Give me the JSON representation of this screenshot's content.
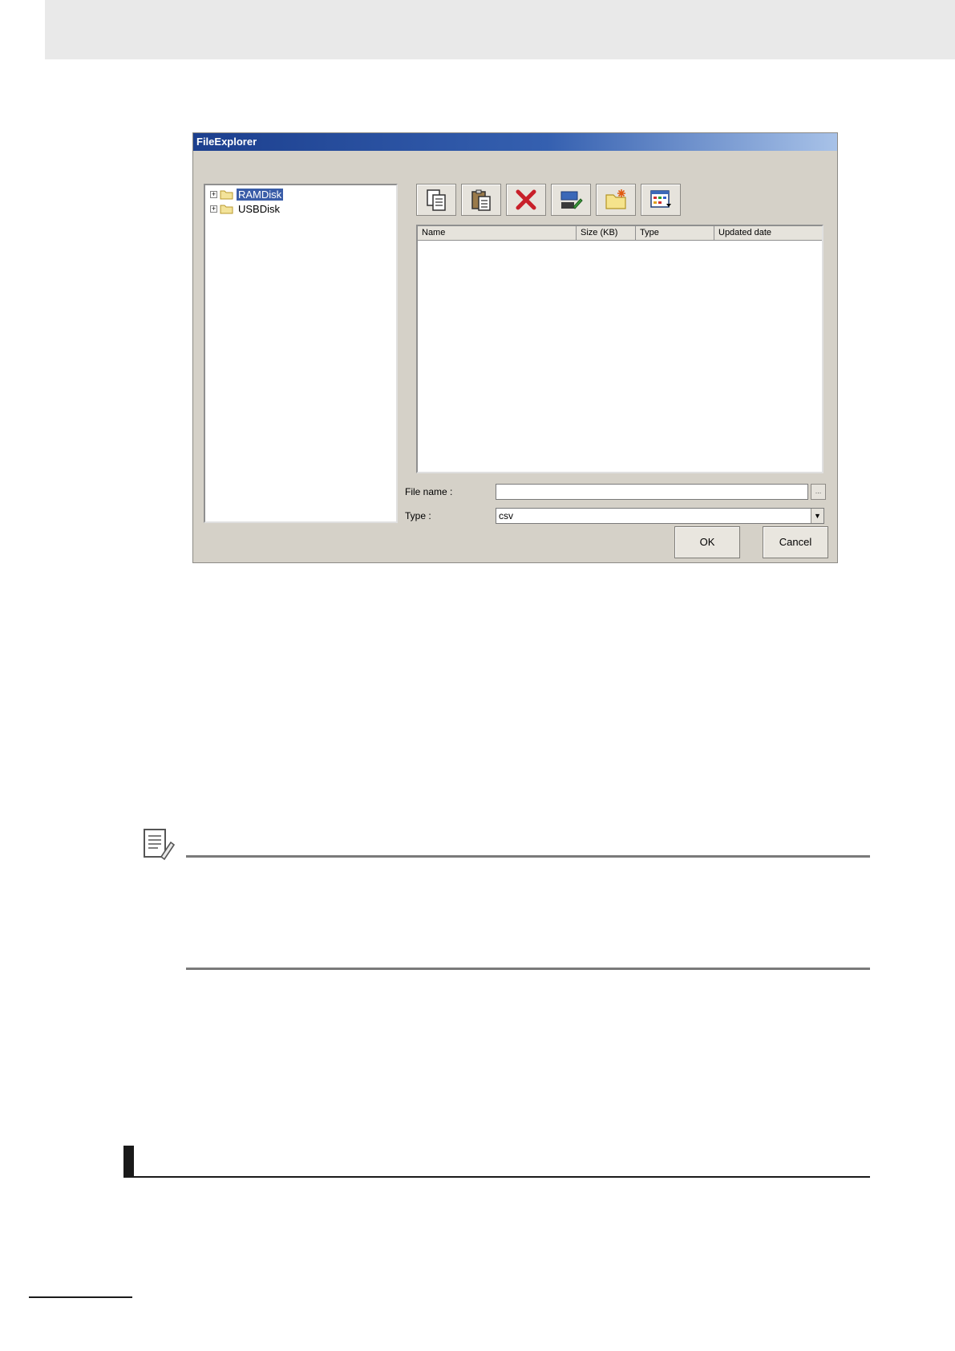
{
  "dialog": {
    "title": "FileExplorer",
    "tree": {
      "items": [
        {
          "label": "RAMDisk",
          "selected": true
        },
        {
          "label": "USBDisk",
          "selected": false
        }
      ]
    },
    "toolbar": {
      "buttons": [
        {
          "name": "copy-button",
          "icon": "copy-icon"
        },
        {
          "name": "paste-button",
          "icon": "paste-icon"
        },
        {
          "name": "delete-button",
          "icon": "delete-x-icon"
        },
        {
          "name": "rename-button",
          "icon": "rename-icon"
        },
        {
          "name": "new-folder-button",
          "icon": "new-folder-icon"
        },
        {
          "name": "view-button",
          "icon": "view-grid-icon"
        }
      ]
    },
    "file_list": {
      "columns": [
        "Name",
        "Size (KB)",
        "Type",
        "Updated date"
      ],
      "rows": []
    },
    "file_name": {
      "label": "File name :",
      "value": "",
      "browse_label": "..."
    },
    "type": {
      "label": "Type :",
      "value": "csv"
    },
    "ok_label": "OK",
    "cancel_label": "Cancel"
  },
  "colors": {
    "dialog_background": "#d5d1c8",
    "titlebar": "#1c3f8e",
    "selection": "#3a5da8"
  }
}
